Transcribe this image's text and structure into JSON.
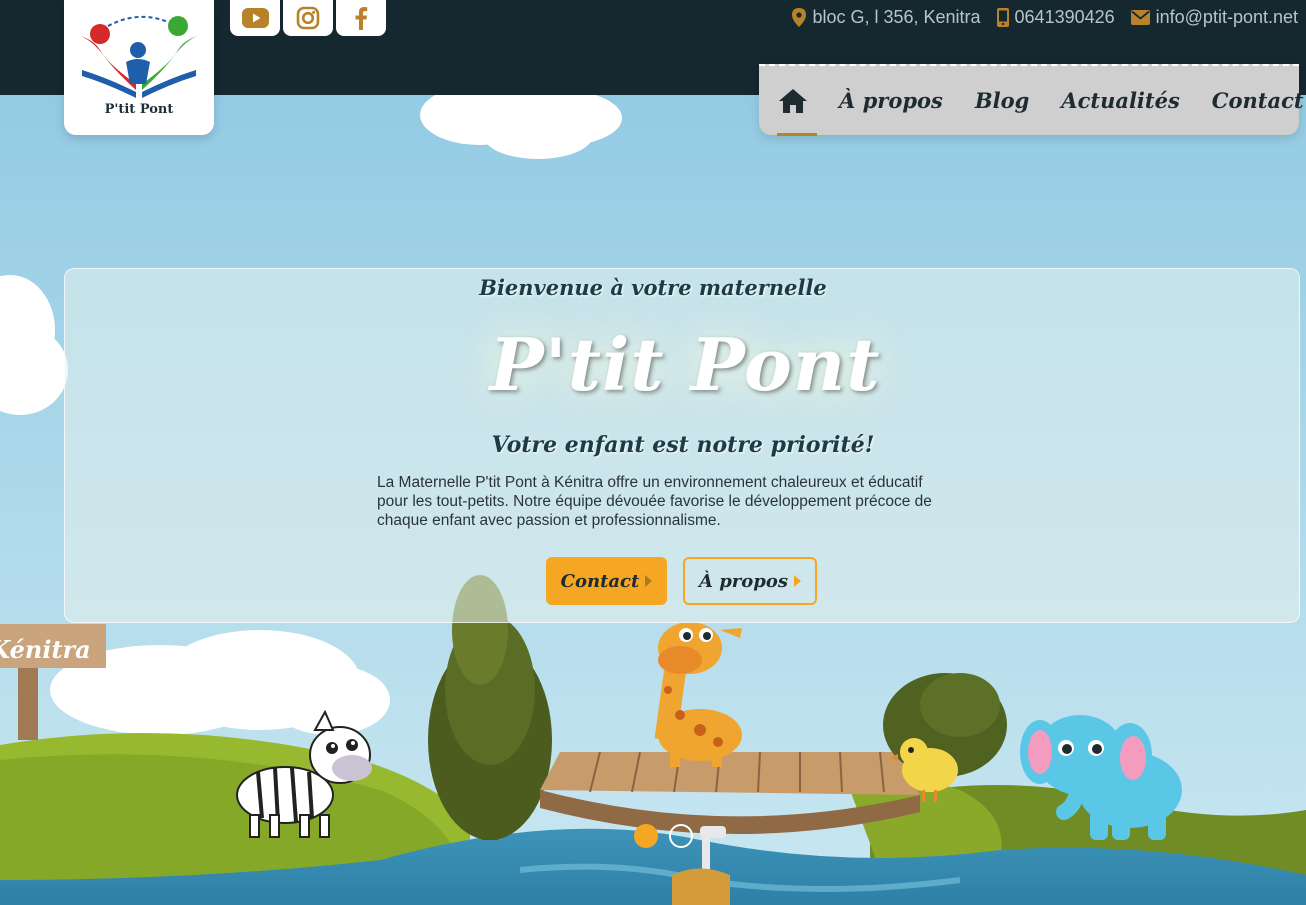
{
  "brand": {
    "logo_text": "P'tit Pont"
  },
  "social": [
    {
      "name": "youtube-icon",
      "color": "#b7822a"
    },
    {
      "name": "instagram-icon",
      "color": "#b7822a"
    },
    {
      "name": "facebook-icon",
      "color": "#b7822a"
    }
  ],
  "contact": {
    "address": "bloc G, l 356, Kenitra",
    "phone": "0641390426",
    "email": "info@ptit-pont.net"
  },
  "nav": {
    "home_icon": "home-icon",
    "items": [
      {
        "label": "À propos"
      },
      {
        "label": "Blog"
      },
      {
        "label": "Actualités"
      },
      {
        "label": "Contact"
      }
    ],
    "active": "home"
  },
  "hero": {
    "kicker": "Bienvenue à votre maternelle",
    "title": "P'tit Pont",
    "subtitle": "Votre enfant est notre priorité!",
    "description": "La Maternelle P'tit Pont à Kénitra offre un environnement chaleureux et éducatif pour les tout-petits. Notre équipe dévouée favorise le développement précoce de chaque enfant avec passion et professionnalisme.",
    "btn_contact": "Contact",
    "btn_apropos": "À propos"
  },
  "scene": {
    "sign_text": "Kénitra"
  },
  "slider": {
    "count": 2,
    "active": 1
  },
  "colors": {
    "topbar": "#15282f",
    "accent": "#f5a623",
    "icon_gold": "#b7822a",
    "nav_bg": "#cfcfcf",
    "sky": "#9dd0e6"
  }
}
